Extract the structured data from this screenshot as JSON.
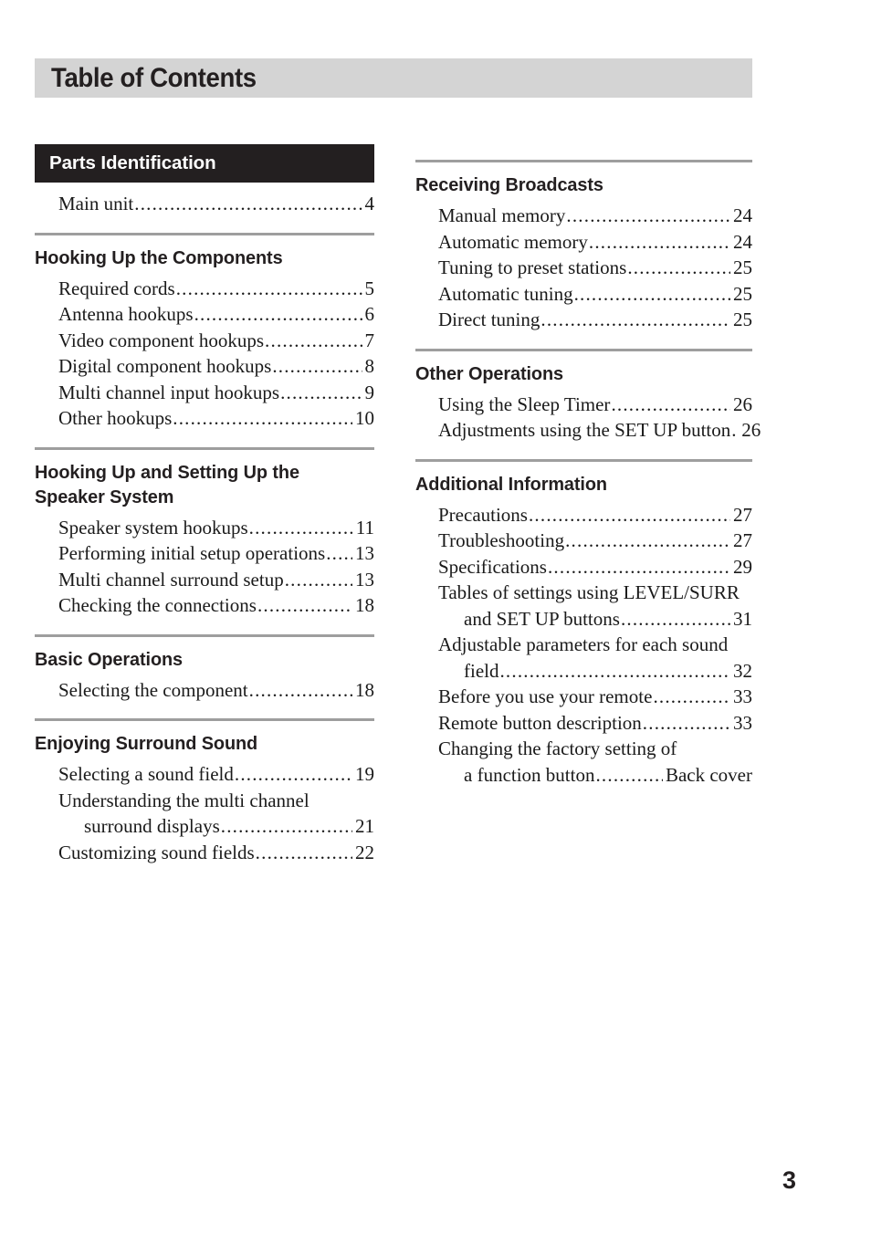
{
  "page": {
    "title": "Table of Contents",
    "folio": "3"
  },
  "left_column": [
    {
      "heading": "Parts Identification",
      "style": "inverted",
      "rule": false,
      "entries": [
        {
          "label": "Main unit",
          "page": "4"
        }
      ]
    },
    {
      "heading": "Hooking Up the Components",
      "style": "plain",
      "rule": true,
      "entries": [
        {
          "label": "Required cords",
          "page": "5"
        },
        {
          "label": "Antenna hookups",
          "page": "6"
        },
        {
          "label": "Video component hookups",
          "page": "7"
        },
        {
          "label": "Digital component hookups",
          "page": "8"
        },
        {
          "label": "Multi channel input hookups",
          "page": "9"
        },
        {
          "label": "Other hookups",
          "page": "10"
        }
      ]
    },
    {
      "heading": "Hooking Up and Setting Up the Speaker System",
      "style": "plain",
      "rule": true,
      "entries": [
        {
          "label": "Speaker system hookups",
          "page": "11"
        },
        {
          "label": "Performing initial setup operations",
          "page": "13"
        },
        {
          "label": "Multi channel surround setup",
          "page": "13"
        },
        {
          "label": "Checking the connections",
          "page": "18"
        }
      ]
    },
    {
      "heading": "Basic Operations",
      "style": "plain",
      "rule": true,
      "entries": [
        {
          "label": "Selecting the component",
          "page": "18"
        }
      ]
    },
    {
      "heading": "Enjoying Surround Sound",
      "style": "plain",
      "rule": true,
      "entries": [
        {
          "label": "Selecting a sound field",
          "page": "19"
        },
        {
          "line1": "Understanding the multi channel",
          "line2": "surround displays",
          "page": "21"
        },
        {
          "label": "Customizing sound fields",
          "page": "22"
        }
      ]
    }
  ],
  "right_column": [
    {
      "heading": "Receiving Broadcasts",
      "style": "plain",
      "rule": true,
      "entries": [
        {
          "label": "Manual memory",
          "page": "24"
        },
        {
          "label": "Automatic memory",
          "page": "24"
        },
        {
          "label": "Tuning to preset stations",
          "page": "25"
        },
        {
          "label": "Automatic tuning",
          "page": "25"
        },
        {
          "label": "Direct tuning",
          "page": "25"
        }
      ]
    },
    {
      "heading": "Other Operations",
      "style": "plain",
      "rule": true,
      "entries": [
        {
          "label": "Using the Sleep Timer",
          "page": "26"
        },
        {
          "label": "Adjustments using the SET UP button",
          "page": "26"
        }
      ]
    },
    {
      "heading": "Additional Information",
      "style": "plain",
      "rule": true,
      "entries": [
        {
          "label": "Precautions",
          "page": "27"
        },
        {
          "label": "Troubleshooting",
          "page": "27"
        },
        {
          "label": "Specifications",
          "page": "29"
        },
        {
          "line1": "Tables of settings using LEVEL/SURR",
          "line2": "and SET UP buttons",
          "page": "31"
        },
        {
          "line1": "Adjustable parameters for each sound",
          "line2": "field",
          "page": "32"
        },
        {
          "label": "Before you use your remote",
          "page": "33"
        },
        {
          "label": "Remote button description",
          "page": "33"
        },
        {
          "line1": "Changing the factory setting of",
          "line2": "a function button",
          "page": "Back cover"
        }
      ]
    }
  ]
}
